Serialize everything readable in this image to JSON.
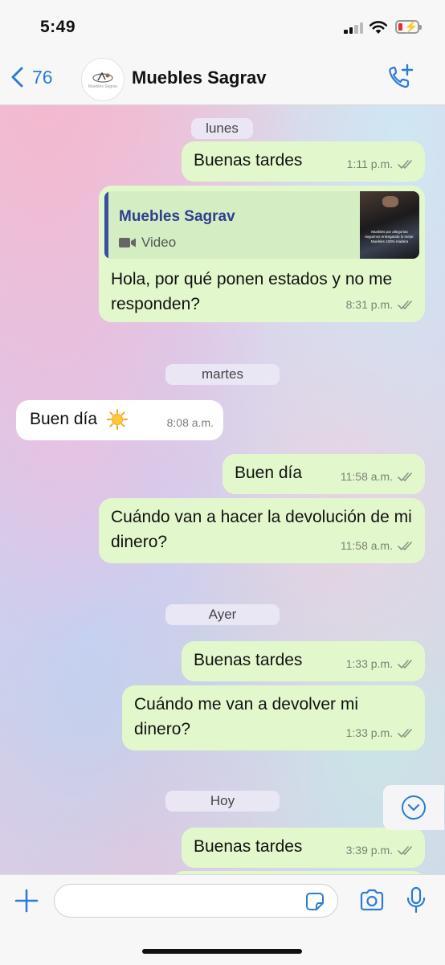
{
  "status_bar": {
    "time": "5:49"
  },
  "nav": {
    "back_count": "76",
    "contact_name": "Muebles Sagrav",
    "avatar_text": "Muebles Sagrav"
  },
  "chat": {
    "day_labels": [
      "lunes",
      "martes",
      "Ayer",
      "Hoy"
    ],
    "messages": [
      {
        "direction": "out",
        "text": "Buenas tardes",
        "time": "1:11 p.m."
      },
      {
        "direction": "out",
        "reply_to_name": "Muebles Sagrav",
        "reply_to_type": "Video",
        "thumb_text": "Muebles por allegorías seguimos entregando lo mejor. Muebles 100% madera",
        "text": "Hola, por qué ponen estados y no me responden?",
        "time": "8:31 p.m."
      },
      {
        "direction": "in",
        "text": "Buen día",
        "emoji": "sun",
        "time": "8:08 a.m."
      },
      {
        "direction": "out",
        "text": "Buen día",
        "time": "11:58 a.m."
      },
      {
        "direction": "out",
        "text": "Cuándo van a hacer la devolución de mi dinero?",
        "time": "11:58 a.m."
      },
      {
        "direction": "out",
        "text": "Buenas tardes",
        "time": "1:33 p.m."
      },
      {
        "direction": "out",
        "text": "Cuándo me van a devolver mi dinero?",
        "time": "1:33 p.m."
      },
      {
        "direction": "out",
        "text": "Buenas tardes",
        "time": "3:39 p.m."
      }
    ]
  },
  "input": {
    "placeholder": ""
  },
  "colors": {
    "accent": "#2b7cd3",
    "outgoing_bubble": "#e2f8cc",
    "incoming_bubble": "#ffffff",
    "reply_quote_name": "#2e3f8f"
  },
  "icons": [
    "back-chevron-icon",
    "call-add-icon",
    "double-check-icon",
    "video-camera-icon",
    "sun-emoji-icon",
    "chevron-down-icon",
    "plus-icon",
    "sticker-icon",
    "camera-icon",
    "microphone-icon"
  ]
}
